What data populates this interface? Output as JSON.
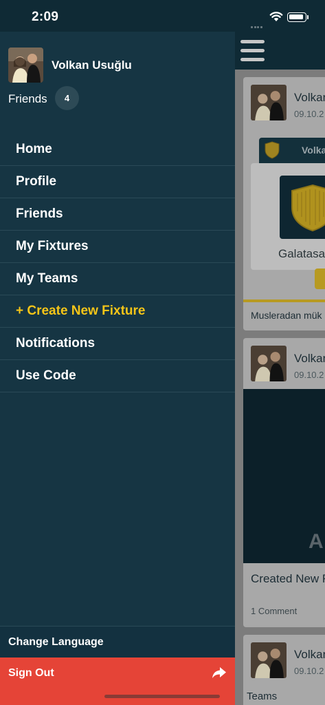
{
  "status_bar": {
    "time": "2:09"
  },
  "profile": {
    "name": "Volkan Usuğlu",
    "friends_label": "Friends",
    "friends_count": "4"
  },
  "menu": {
    "items": [
      {
        "label": "Home"
      },
      {
        "label": "Profile"
      },
      {
        "label": "Friends"
      },
      {
        "label": "My Fixtures"
      },
      {
        "label": "My Teams"
      },
      {
        "label": "+ Create New Fixture",
        "accent": true
      },
      {
        "label": "Notifications"
      },
      {
        "label": "Use Code"
      }
    ]
  },
  "footer": {
    "change_language": "Change Language",
    "sign_out": "Sign Out"
  },
  "feed": {
    "cards": [
      {
        "author": "Volkan",
        "date": "09.10.2",
        "fixture_title": "Volka",
        "team_name": "Galatasa",
        "comment": "Musleradan mük"
      },
      {
        "author": "Volkan",
        "date": "09.10.2",
        "media_letter": "A",
        "text": "Created New F",
        "comment_count": "1 Comment"
      },
      {
        "author": "Volkan",
        "date": "09.10.2",
        "section": "Teams"
      }
    ]
  },
  "colors": {
    "accent": "#f5c518",
    "drawer_bg": "#163543",
    "sign_out_bg": "#e54437"
  }
}
